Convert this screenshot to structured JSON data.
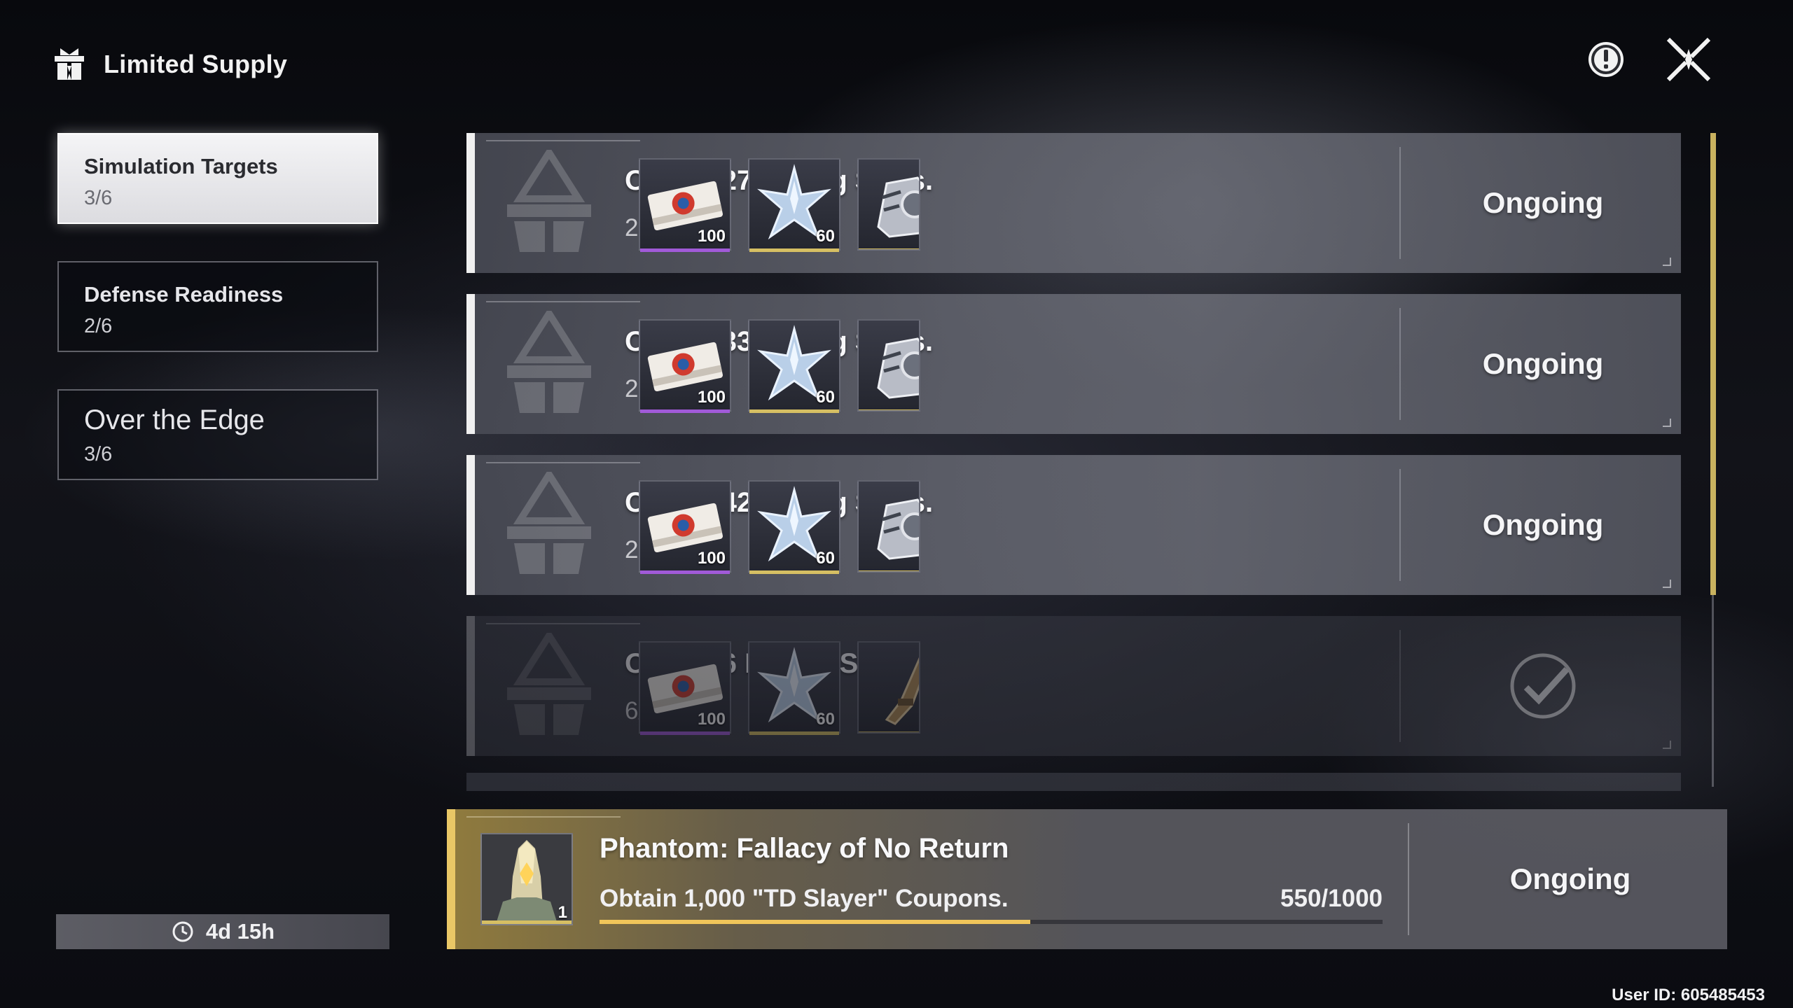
{
  "header": {
    "title": "Limited Supply"
  },
  "sidebar": {
    "tabs": [
      {
        "name": "Simulation Targets",
        "count": "3/6",
        "active": true
      },
      {
        "name": "Defense Readiness",
        "count": "2/6",
        "active": false
      },
      {
        "name": "Over the Edge",
        "count": "3/6",
        "active": false
      }
    ],
    "timer": "4d 15h"
  },
  "missions": [
    {
      "title": "Obtain 27 Rating Stars.",
      "progress": "25/27",
      "status": "Ongoing",
      "rewards": [
        {
          "icon": "coupon-ticket-icon",
          "qty": "100"
        },
        {
          "icon": "crystal-star-icon",
          "qty": "60"
        },
        {
          "icon": "equipment-icon",
          "qty": ""
        }
      ]
    },
    {
      "title": "Obtain 33 Rating Stars.",
      "progress": "25/33",
      "status": "Ongoing",
      "rewards": [
        {
          "icon": "coupon-ticket-icon",
          "qty": "100"
        },
        {
          "icon": "crystal-star-icon",
          "qty": "60"
        },
        {
          "icon": "equipment-icon",
          "qty": ""
        }
      ]
    },
    {
      "title": "Obtain 42 Rating Stars.",
      "progress": "25/42",
      "status": "Ongoing",
      "rewards": [
        {
          "icon": "coupon-ticket-icon",
          "qty": "100"
        },
        {
          "icon": "crystal-star-icon",
          "qty": "60"
        },
        {
          "icon": "equipment-icon",
          "qty": ""
        }
      ]
    },
    {
      "title": "Obtain 6 Rating Stars.",
      "progress": "6/6",
      "status": "completed",
      "rewards": [
        {
          "icon": "coupon-ticket-icon",
          "qty": "100"
        },
        {
          "icon": "crystal-star-icon",
          "qty": "60"
        },
        {
          "icon": "weapon-icon",
          "qty": ""
        }
      ]
    }
  ],
  "phantom": {
    "title": "Phantom: Fallacy of No Return",
    "description": "Obtain 1,000 \"TD Slayer\" Coupons.",
    "count": "550/1000",
    "progress_fraction": 0.55,
    "reward_qty": "1",
    "status": "Ongoing"
  },
  "user_id": "User ID: 605485453",
  "colors": {
    "accent_gold": "#e9c766",
    "purple_rarity": "#a15ad8",
    "gold_rarity": "#d6bf63"
  }
}
